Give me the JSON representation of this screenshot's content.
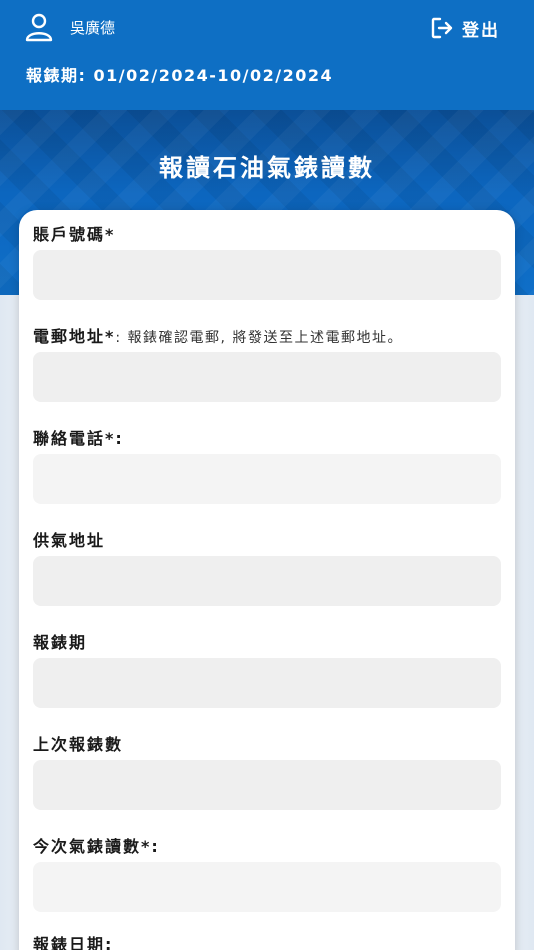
{
  "header": {
    "user_name": "吳廣德",
    "logout_label": "登出",
    "period_text": "報錶期: 01/02/2024-10/02/2024"
  },
  "title": "報讀石油氣錶讀數",
  "form": {
    "account": {
      "label": "賬戶號碼*",
      "value": ""
    },
    "email": {
      "label": "電郵地址*",
      "note": ": 報錶確認電郵, 將發送至上述電郵地址。",
      "value": ""
    },
    "phone": {
      "label": "聯絡電話*:",
      "value": ""
    },
    "address": {
      "label": "供氣地址",
      "value": ""
    },
    "period": {
      "label": "報錶期",
      "value": ""
    },
    "last_reading": {
      "label": "上次報錶數",
      "value": ""
    },
    "current_reading": {
      "label": "今次氣錶讀數*:",
      "value": ""
    },
    "report_date": {
      "label": "報錶日期:"
    }
  },
  "colors": {
    "header_blue": "#0e6fc4",
    "input_bg": "#efefef"
  },
  "icons": {
    "user": "user-icon",
    "logout": "logout-icon"
  }
}
